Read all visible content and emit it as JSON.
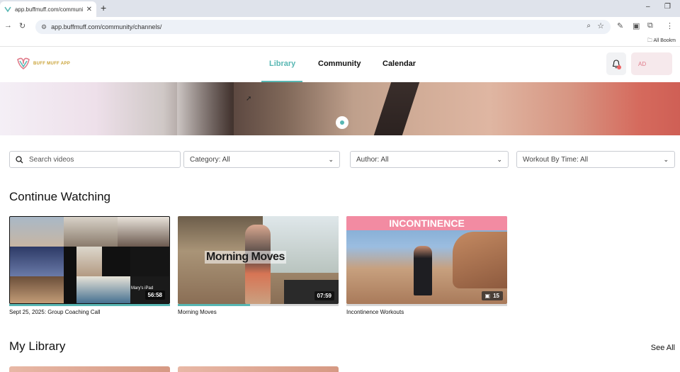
{
  "browser": {
    "tab_title": "app.buffmuff.com/community/ch",
    "url": "app.buffmuff.com/community/channels/",
    "bookmarks_label": "All Bookm"
  },
  "app": {
    "logo_text": "BUFF MUFF APP",
    "nav": [
      {
        "label": "Library",
        "active": true
      },
      {
        "label": "Community",
        "active": false
      },
      {
        "label": "Calendar",
        "active": false
      }
    ],
    "avatar_initials": "AD",
    "accent_color": "#58b7b3"
  },
  "filters": {
    "search_placeholder": "Search videos",
    "category": "Category: All",
    "author": "Author: All",
    "workout_time": "Workout By Time: All"
  },
  "continue_watching": {
    "title": "Continue Watching",
    "items": [
      {
        "title": "Sept 25, 2025: Group Coaching Call",
        "duration": "56:58",
        "name_tag": "Mary's iPad",
        "progress": 1.0
      },
      {
        "title": "Morning Moves",
        "duration": "07:59",
        "overlay_text": "Morning Moves",
        "progress": 0.45
      },
      {
        "title": "Incontinence Workouts",
        "count": "15",
        "banner": "INCONTINENCE",
        "progress": 0
      }
    ]
  },
  "my_library": {
    "title": "My Library",
    "see_all": "See All"
  }
}
